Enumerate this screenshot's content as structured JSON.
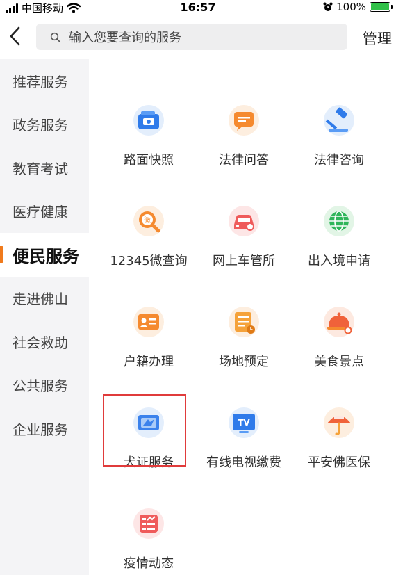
{
  "status_bar": {
    "carrier": "中国移动",
    "time": "16:57",
    "battery": "100%",
    "battery_level": 1.0
  },
  "nav": {
    "search_placeholder": "输入您要查询的服务",
    "manage_label": "管理"
  },
  "sidebar": {
    "items": [
      {
        "label": "推荐服务",
        "active": false
      },
      {
        "label": "政务服务",
        "active": false
      },
      {
        "label": "教育考试",
        "active": false
      },
      {
        "label": "医疗健康",
        "active": false
      },
      {
        "label": "便民服务",
        "active": true
      },
      {
        "label": "走进佛山",
        "active": false
      },
      {
        "label": "社会救助",
        "active": false
      },
      {
        "label": "公共服务",
        "active": false
      },
      {
        "label": "企业服务",
        "active": false
      }
    ]
  },
  "services": [
    {
      "label": "路面快照",
      "icon": "camera-icon"
    },
    {
      "label": "法律问答",
      "icon": "chat-bubble-icon"
    },
    {
      "label": "法律咨询",
      "icon": "gavel-icon"
    },
    {
      "label": "12345微查询",
      "icon": "magnifier-icon"
    },
    {
      "label": "网上车管所",
      "icon": "car-icon"
    },
    {
      "label": "出入境申请",
      "icon": "globe-icon"
    },
    {
      "label": "户籍办理",
      "icon": "id-card-icon"
    },
    {
      "label": "场地预定",
      "icon": "calendar-clock-icon"
    },
    {
      "label": "美食景点",
      "icon": "food-cloche-icon"
    },
    {
      "label": "犬证服务",
      "icon": "dog-license-icon"
    },
    {
      "label": "有线电视缴费",
      "icon": "tv-icon"
    },
    {
      "label": "平安佛医保",
      "icon": "umbrella-icon"
    },
    {
      "label": "疫情动态",
      "icon": "chart-list-icon"
    }
  ],
  "highlight": {
    "service_label": "犬证服务",
    "color": "#e03b3b"
  },
  "colors": {
    "accent": "#f07a1c",
    "sidebar_bg": "#f4f4f6"
  }
}
